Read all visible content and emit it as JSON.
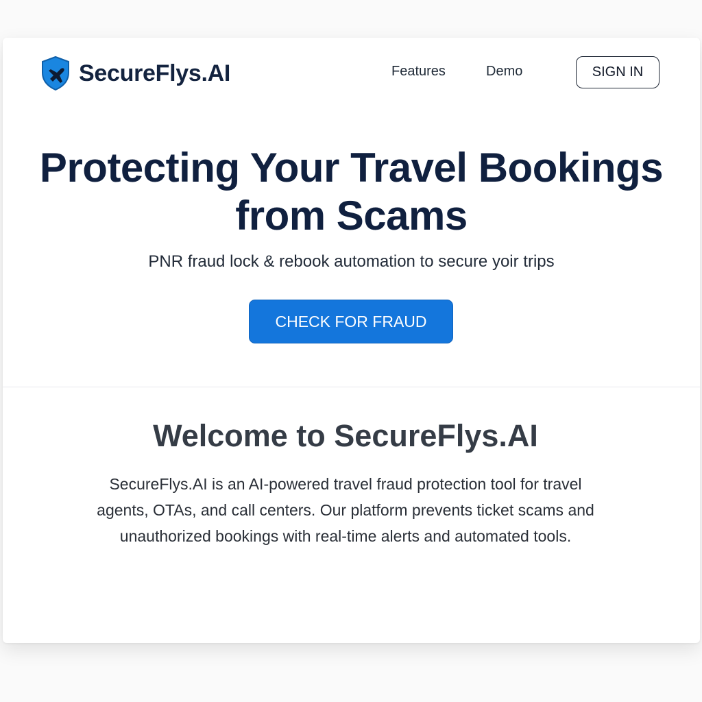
{
  "brand": {
    "name": "SecureFlys.AI",
    "logo_icon": "shield-plane-icon",
    "logo_color": "#1a86e0"
  },
  "nav": {
    "features_label": "Features",
    "demo_label": "Demo",
    "signin_label": "SIGN IN"
  },
  "hero": {
    "title": "Protecting Your Travel Bookings from Scams",
    "subtitle": "PNR fraud lock & rebook automation to secure yoir trips",
    "cta_label": "CHECK FOR FRAUD",
    "cta_color": "#1476dc"
  },
  "welcome": {
    "title": "Welcome to SecureFlys.AI",
    "body": "SecureFlys.AI is an AI-powered travel fraud protection tool for travel agents, OTAs, and call centers. Our platform prevents ticket scams and unauthorized bookings with real-time alerts and automated tools."
  }
}
